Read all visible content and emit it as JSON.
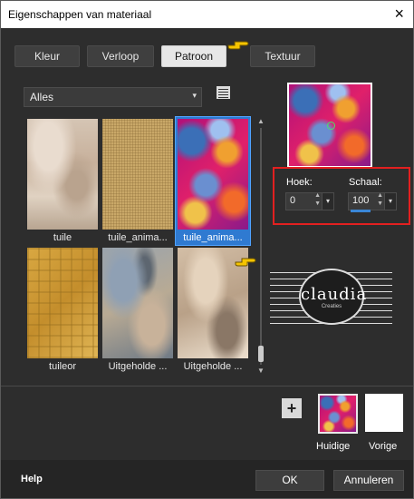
{
  "window": {
    "title": "Eigenschappen van materiaal",
    "close_icon": "×"
  },
  "tabs": [
    {
      "label": "Kleur",
      "active": false
    },
    {
      "label": "Verloop",
      "active": false
    },
    {
      "label": "Patroon",
      "active": true
    },
    {
      "label": "Textuur",
      "active": false
    }
  ],
  "filter": {
    "value": "Alles",
    "caret": "▾"
  },
  "patterns": [
    {
      "name": "tuile",
      "icon": "tuile-pattern-thumbnail"
    },
    {
      "name": "tuile_anima...",
      "icon": "tuile-animated-pattern-thumbnail"
    },
    {
      "name": "tuile_anima...",
      "icon": "colorful-pattern-thumbnail",
      "selected": true
    },
    {
      "name": "tuileor",
      "icon": "gold-tile-pattern-thumbnail"
    },
    {
      "name": "Uitgeholde ...",
      "icon": "rock-pattern-thumbnail"
    },
    {
      "name": "Uitgeholde ...",
      "icon": "stone-pattern-thumbnail"
    }
  ],
  "angle": {
    "label": "Hoek:",
    "value": "0"
  },
  "scale": {
    "label": "Schaal:",
    "value": "100"
  },
  "watermark": {
    "name": "claudia",
    "tag": "Creaties"
  },
  "swatches": {
    "add": "+",
    "current_label": "Huidige",
    "previous_label": "Vorige"
  },
  "footer": {
    "help": "Help",
    "ok": "OK",
    "cancel": "Annuleren"
  },
  "colors": {
    "selection": "#2f7ad1",
    "highlight": "#e22020",
    "pointer": "#f5c400"
  }
}
